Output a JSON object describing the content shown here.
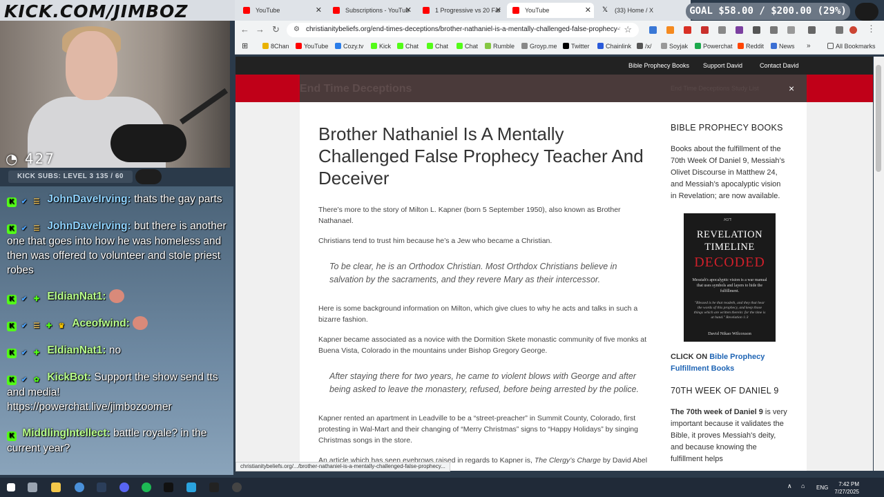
{
  "overlay": {
    "stream_url": "KICK.COM/JIMBOZ",
    "viewer_count": "427",
    "sub_bar": "KICK SUBS: LEVEL 3 135 / 60",
    "goal": "GOAL $58.00 / $200.00 (29%)",
    "goal_progress": 0.29
  },
  "chat": [
    {
      "user": "JohnDaveIrving:",
      "text": "thats the gay parts",
      "user_color": "#8fd3ff"
    },
    {
      "user": "JohnDaveIrving:",
      "text": "but there is another one that goes into how he was homeless and then was offered to volunteer and stole priest robes",
      "user_color": "#8fd3ff"
    },
    {
      "user": "EldianNat1:",
      "text": "",
      "user_color": "#b8ff8a"
    },
    {
      "user": "Aceofwind:",
      "text": "",
      "user_color": "#b8ff8a"
    },
    {
      "user": "EldianNat1:",
      "text": "no",
      "user_color": "#b8ff8a"
    },
    {
      "user": "KickBot:",
      "text": "Support the show send tts and media! https://powerchat.live/jimbozoomer",
      "user_color": "#b8ff8a"
    },
    {
      "user": "MiddlingIntellect:",
      "text": "battle royale? in the current year?",
      "user_color": "#b8ff8a"
    }
  ],
  "tabs": [
    {
      "title": "YouTube"
    },
    {
      "title": "Subscriptions - YouTub"
    },
    {
      "title": "1 Progressive vs 20 Far"
    },
    {
      "title": "YouTube"
    },
    {
      "title": "(33) Home / X"
    }
  ],
  "browser": {
    "url": "christianitybeliefs.org/end-times-deceptions/brother-nathaniel-is-a-mentally-challenged-false-prophecy-teac...",
    "status_url": "christianitybeliefs.org/.../brother-nathaniel-is-a-mentally-challenged-false-prophecy..."
  },
  "bookmarks": [
    "8Chan",
    "YouTube",
    "Cozy.tv",
    "Kick",
    "Chat",
    "Chat",
    "Chat",
    "Rumble",
    "Groyp.me",
    "Twitter",
    "Chainlink",
    "/x/",
    "Soyjak",
    "Powerchat",
    "Reddit",
    "News",
    "All Bookmarks"
  ],
  "site": {
    "nav": [
      "Bible Prophecy Books",
      "Support David",
      "Contact David"
    ],
    "section_title": "End Time Deceptions",
    "search_text": "End Time Deceptions Study List",
    "close": "×"
  },
  "article": {
    "title": "Brother Nathaniel Is A Mentally Challenged False Prophecy Teacher And Deceiver",
    "p1": "There’s more to the story of Milton L. Kapner (born 5 September 1950), also known as Brother Nathanael.",
    "p2": "Christians tend to trust him because he’s a Jew who became a Christian.",
    "quote1": "To be clear, he is an Orthodox Christian.  Most Orthdox Christians believe in salvation by the sacraments, and they revere Mary as their intercessor.",
    "p3": "Here is some background information on Milton, which give clues to why he acts and talks in such a bizarre fashion.",
    "p4": "Kapner became associated as a novice with the Dormition Skete monastic community of five monks at Buena Vista, Colorado in the mountains under Bishop Gregory George.",
    "quote2": "After staying there for two years, he came to violent blows with George and after being asked to leave the monastery, refused, before being arrested by the police.",
    "p5": "Kapner rented an apartment in Leadville to be a “street-preacher” in Summit County, Colorado, first protesting in Wal-Mart and their changing of “Merry Christmas” signs to “Happy Holidays” by singing Christmas songs in the store.",
    "p6_start": "An article which has seen eyebrows raised in regards to Kapner is, ",
    "p6_italic": "The Clergy’s Charge",
    "p6_end": " by David Abel"
  },
  "sidebar": {
    "heading1": "BIBLE PROPHECY BOOKS",
    "text1": "Books about the fulfillment of the 70th Week Of Daniel 9, Messiah’s Olivet Discourse in Matthew 24, and Messiah’s apocalyptic vision in Revelation; are now available.",
    "book": {
      "mark": "דנא",
      "title_line1": "REVELATION",
      "title_line2": "TIMELINE",
      "title_line3": "DECODED",
      "tagline": "Messiah's apocalyptic vision is a war manual that uses symbols and layers to hide the fulfillment.",
      "quote": "\"Blessed is he that readeth, and they that hear the words of this prophecy, and keep those things which are written therein: for the time is at hand.\" Revelation 1:3",
      "author": "David Nikao Wilcoxson"
    },
    "click_on": "CLICK ON",
    "click_link": "Bible Prophecy Fulfillment Books",
    "heading2": "70TH WEEK OF DANIEL 9",
    "text2_bold": "The 70th week of Daniel 9",
    "text2": " is very important because it validates the Bible, it proves Messiah's deity, and because knowing the fulfillment helps"
  },
  "taskbar": {
    "lang": "ENG",
    "time": "7:42 PM",
    "date": "7/27/2025"
  },
  "colors": {
    "red_band": "#c00018",
    "link": "#1e64b4",
    "kick_green": "#53fc18"
  }
}
